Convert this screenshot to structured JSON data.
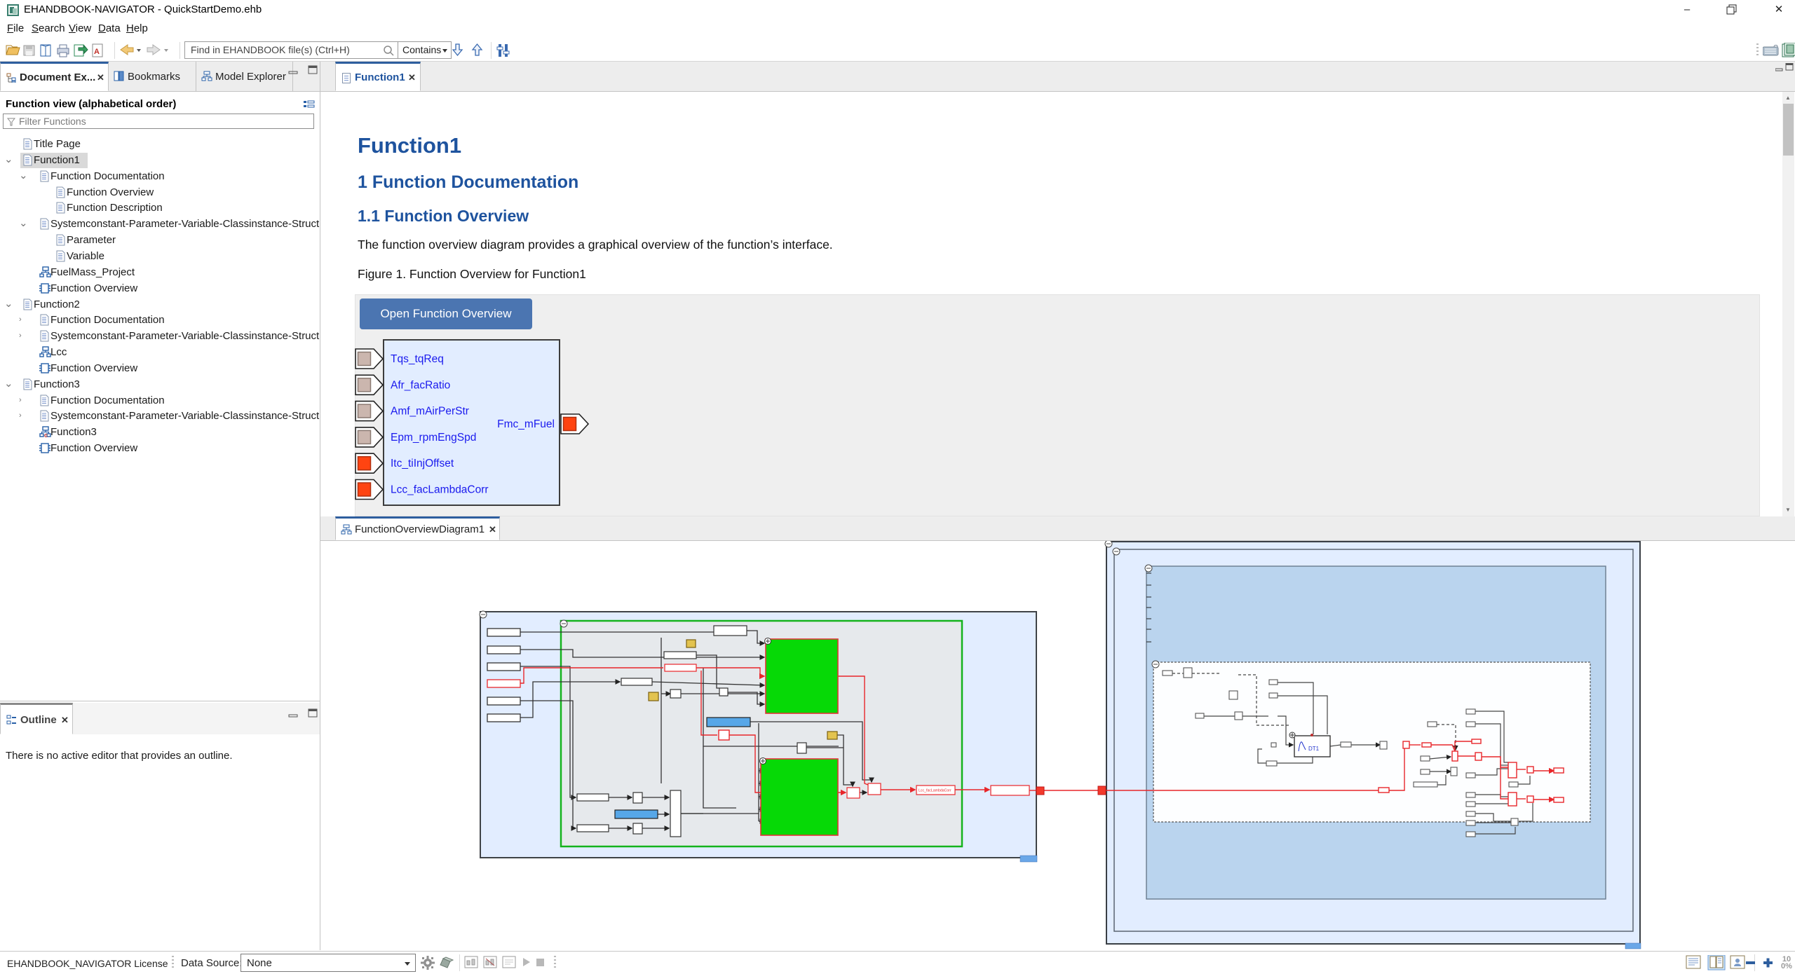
{
  "window": {
    "title": "EHANDBOOK-NAVIGATOR - QuickStartDemo.ehb",
    "menus": [
      "File",
      "Search",
      "View",
      "Data",
      "Help"
    ]
  },
  "toolbar": {
    "search_placeholder": "Find in EHANDBOOK file(s) (Ctrl+H)",
    "contains_label": "Contains"
  },
  "left_panel": {
    "tabs": [
      "Document Ex...",
      "Bookmarks",
      "Model Explorer"
    ],
    "view_title": "Function view (alphabetical order)",
    "filter_placeholder": "Filter Functions",
    "tree": [
      {
        "label": "Title Page",
        "level": 0,
        "icon": "doc",
        "arrow": ""
      },
      {
        "label": "Function1",
        "level": 0,
        "icon": "doc",
        "arrow": "v",
        "selected": true
      },
      {
        "label": "Function Documentation",
        "level": 1,
        "icon": "doc",
        "arrow": "v"
      },
      {
        "label": "Function Overview",
        "level": 2,
        "icon": "doc",
        "arrow": ""
      },
      {
        "label": "Function Description",
        "level": 2,
        "icon": "doc",
        "arrow": ""
      },
      {
        "label": "Systemconstant-Parameter-Variable-Classinstance-Structure",
        "level": 1,
        "icon": "doc",
        "arrow": "v"
      },
      {
        "label": "Parameter",
        "level": 2,
        "icon": "doc",
        "arrow": ""
      },
      {
        "label": "Variable",
        "level": 2,
        "icon": "doc",
        "arrow": ""
      },
      {
        "label": "FuelMass_Project",
        "level": 1,
        "icon": "model",
        "arrow": ""
      },
      {
        "label": "Function Overview",
        "level": 1,
        "icon": "chip",
        "arrow": ""
      },
      {
        "label": "Function2",
        "level": 0,
        "icon": "doc",
        "arrow": "v"
      },
      {
        "label": "Function Documentation",
        "level": 1,
        "icon": "doc",
        "arrow": ">"
      },
      {
        "label": "Systemconstant-Parameter-Variable-Classinstance-Structure",
        "level": 1,
        "icon": "doc",
        "arrow": ">"
      },
      {
        "label": "Lcc",
        "level": 1,
        "icon": "model",
        "arrow": ""
      },
      {
        "label": "Function Overview",
        "level": 1,
        "icon": "chip",
        "arrow": ""
      },
      {
        "label": "Function3",
        "level": 0,
        "icon": "doc",
        "arrow": "v"
      },
      {
        "label": "Function Documentation",
        "level": 1,
        "icon": "doc",
        "arrow": ">"
      },
      {
        "label": "Systemconstant-Parameter-Variable-Classinstance-Structure",
        "level": 1,
        "icon": "doc",
        "arrow": ">"
      },
      {
        "label": "Function3",
        "level": 1,
        "icon": "model-c",
        "arrow": ""
      },
      {
        "label": "Function Overview",
        "level": 1,
        "icon": "chip",
        "arrow": ""
      }
    ]
  },
  "outline": {
    "tab_label": "Outline",
    "message": "There is no active editor that provides an outline."
  },
  "editor": {
    "tab_label": "Function1",
    "h1": "Function1",
    "h2": "1 Function Documentation",
    "h3": "1.1 Function Overview",
    "paragraph": "The function overview diagram provides a graphical overview of the function’s interface.",
    "figure_caption": "Figure 1. Function Overview for Function1",
    "open_button": "Open Function Overview",
    "block": {
      "inputs": [
        {
          "label": "Tqs_tqReq",
          "color": "gray"
        },
        {
          "label": "Afr_facRatio",
          "color": "gray"
        },
        {
          "label": "Amf_mAirPerStr",
          "color": "gray"
        },
        {
          "label": "Epm_rpmEngSpd",
          "color": "gray"
        },
        {
          "label": "Itc_tiInjOffset",
          "color": "red"
        },
        {
          "label": "Lcc_facLambdaCorr",
          "color": "red"
        }
      ],
      "output": {
        "label": "Fmc_mFuel",
        "color": "red"
      }
    }
  },
  "bottom_panel": {
    "tab_label": "FunctionOverviewDiagram1",
    "diagram_labels": {
      "signal": "Lcc_facLambdaCorr",
      "dt_block": "DT1"
    }
  },
  "statusbar": {
    "license": "EHANDBOOK_NAVIGATOR License",
    "data_source_label": "Data Source:",
    "data_source_value": "None",
    "zoom": "100%"
  },
  "colors": {
    "accent_blue": "#2e5e9e",
    "heading": "#1e539e",
    "button": "#4b75b1",
    "block_fill": "#e2edff",
    "green_block": "#06d906",
    "port_red": "#ff4411"
  }
}
